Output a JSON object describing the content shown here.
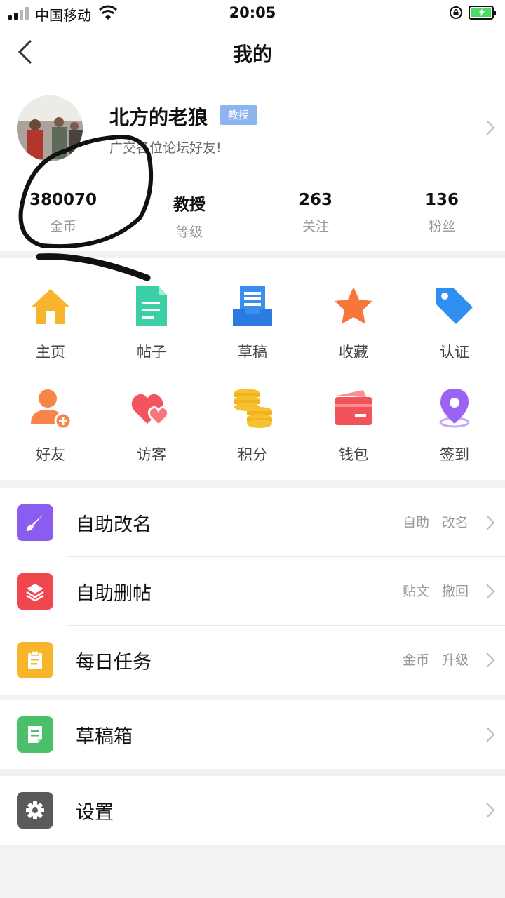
{
  "status_bar": {
    "carrier": "中国移动",
    "time": "20:05"
  },
  "nav": {
    "title": "我的"
  },
  "profile": {
    "username": "北方的老狼",
    "rank_badge": "教授",
    "signature": "广交各位论坛好友!"
  },
  "stats": [
    {
      "value": "380070",
      "label": "金币"
    },
    {
      "value": "教授",
      "label": "等级"
    },
    {
      "value": "263",
      "label": "关注"
    },
    {
      "value": "136",
      "label": "粉丝"
    }
  ],
  "grid": [
    {
      "label": "主页",
      "icon": "home-icon"
    },
    {
      "label": "帖子",
      "icon": "document-icon"
    },
    {
      "label": "草稿",
      "icon": "draft-tray-icon"
    },
    {
      "label": "收藏",
      "icon": "star-icon"
    },
    {
      "label": "认证",
      "icon": "tag-icon"
    },
    {
      "label": "好友",
      "icon": "add-friend-icon"
    },
    {
      "label": "访客",
      "icon": "hearts-icon"
    },
    {
      "label": "积分",
      "icon": "coins-icon"
    },
    {
      "label": "钱包",
      "icon": "wallet-icon"
    },
    {
      "label": "签到",
      "icon": "location-pin-icon"
    }
  ],
  "menu_section_1": [
    {
      "label": "自助改名",
      "tags": [
        "自助",
        "改名"
      ],
      "icon": "brush-icon",
      "color": "#8a5cf0"
    },
    {
      "label": "自助删帖",
      "tags": [
        "贴文",
        "撤回"
      ],
      "icon": "layers-icon",
      "color": "#f0474f"
    },
    {
      "label": "每日任务",
      "tags": [
        "金币",
        "升级"
      ],
      "icon": "clipboard-icon",
      "color": "#f9b52a"
    }
  ],
  "menu_section_2": [
    {
      "label": "草稿箱",
      "icon": "note-icon",
      "color": "#4cbf6a"
    }
  ],
  "menu_section_3": [
    {
      "label": "设置",
      "icon": "gear-icon",
      "color": "#5a5a5a"
    }
  ]
}
